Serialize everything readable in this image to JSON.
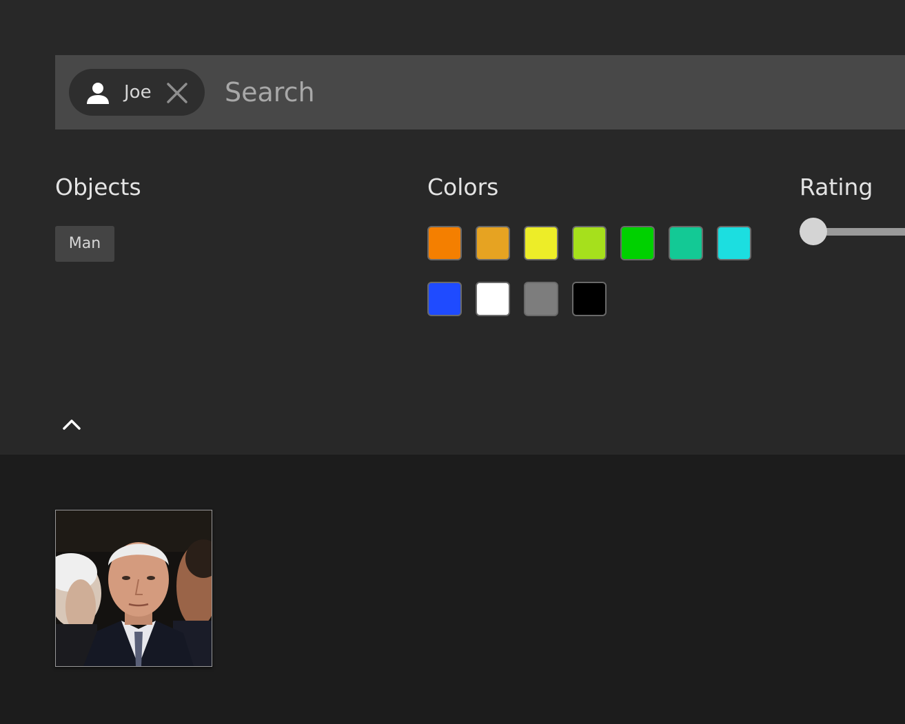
{
  "search": {
    "chip": {
      "label": "Joe",
      "icon": "person-icon",
      "close_icon": "close-icon"
    },
    "placeholder": "Search",
    "value": ""
  },
  "filters": {
    "objects": {
      "title": "Objects",
      "tags": [
        "Man"
      ]
    },
    "colors": {
      "title": "Colors",
      "swatches": [
        {
          "name": "orange",
          "hex": "#f47f00"
        },
        {
          "name": "amber",
          "hex": "#e6a322"
        },
        {
          "name": "yellow",
          "hex": "#eded28"
        },
        {
          "name": "lime",
          "hex": "#a6e01c"
        },
        {
          "name": "green",
          "hex": "#00d100"
        },
        {
          "name": "teal",
          "hex": "#13c995"
        },
        {
          "name": "cyan",
          "hex": "#1cdee0"
        },
        {
          "name": "blue",
          "hex": "#1f4bff"
        },
        {
          "name": "white",
          "hex": "#ffffff"
        },
        {
          "name": "gray",
          "hex": "#7d7d7d"
        },
        {
          "name": "black",
          "hex": "#000000"
        }
      ]
    },
    "rating": {
      "title": "Rating",
      "value": 0
    },
    "collapse_icon": "chevron-up-icon"
  },
  "results": {
    "thumbnails": [
      {
        "type": "photo",
        "subject": "man"
      }
    ]
  }
}
